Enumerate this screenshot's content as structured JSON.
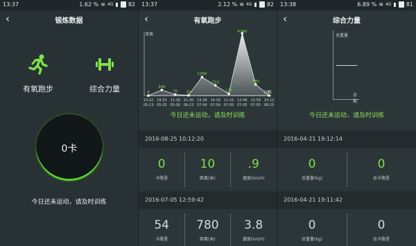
{
  "panels": {
    "p1": {
      "status": {
        "time": "13:37",
        "right": "1.62 % ",
        "signal": "4G",
        "battery": "82"
      },
      "nav": {
        "back": "‹",
        "title": "锻炼数据"
      },
      "categories": [
        {
          "label": "有氧跑步",
          "icon": "running-icon"
        },
        {
          "label": "综合力量",
          "icon": "dumbbell-icon"
        }
      ],
      "ring": {
        "value": "0卡"
      },
      "hint": "今日还未运动，请及时训练"
    },
    "p2": {
      "status": {
        "time": "13:37",
        "right": "2.12 % ",
        "signal": "4G",
        "battery": "82"
      },
      "nav": {
        "back": "‹",
        "title": "有氧跑步"
      },
      "chart_data": {
        "type": "area",
        "y_axis_label": "距离",
        "x_axis_label": "日期",
        "points": [
          {
            "time": "13:22",
            "date": "05-13",
            "value": 0
          },
          {
            "time": "19:33",
            "date": "05-25",
            "value": 390
          },
          {
            "time": "11:18",
            "date": "05-26",
            "value": 70
          },
          {
            "time": "21:30",
            "date": "06-23",
            "value": 20
          },
          {
            "time": "13:38",
            "date": "07-04",
            "value": 1290
          },
          {
            "time": "14:29",
            "date": "07-04",
            "value": 710
          },
          {
            "time": "11:16",
            "date": "07-05",
            "value": 130
          },
          {
            "time": "12:46",
            "date": "07-05",
            "value": 4340
          },
          {
            "time": "12:59",
            "date": "07-05",
            "value": 780
          },
          {
            "time": "10:12",
            "date": "08-25",
            "value": 10
          }
        ],
        "ylim": [
          0,
          4340
        ]
      },
      "hint": "今日还未运动，请及时训练",
      "records": [
        {
          "datetime": "2016-08-25 10:12:20",
          "metrics": [
            {
              "value": "0",
              "caption": "卡路里"
            },
            {
              "value": "10",
              "caption": "距离(米)"
            },
            {
              "value": ".9",
              "caption": "速度(km/h)"
            }
          ]
        },
        {
          "datetime": "2016-07-05 12:59:42",
          "metrics": [
            {
              "value": "54",
              "caption": "卡路里"
            },
            {
              "value": "780",
              "caption": "距离(米)"
            },
            {
              "value": "3.8",
              "caption": "速度(km/h)"
            }
          ]
        }
      ]
    },
    "p3": {
      "status": {
        "time": "13:38",
        "right": "6.89 % ",
        "signal": "4G",
        "battery": "81"
      },
      "nav": {
        "back": "‹",
        "title": "综合力量"
      },
      "chart": {
        "y_axis_label": "总重量",
        "x_axis_label": "日期"
      },
      "hint": "今日还未运动，请及时训练",
      "records": [
        {
          "datetime": "2016-04-21 19:12:14",
          "metrics": [
            {
              "value": "0",
              "caption": "总重量(kg)"
            },
            {
              "value": "0",
              "caption": "总卡路里"
            }
          ]
        },
        {
          "datetime": "2016-04-21 19:11:42",
          "metrics": [
            {
              "value": "0",
              "caption": "总重量(kg)"
            },
            {
              "value": "0",
              "caption": "总卡路里"
            }
          ]
        }
      ]
    }
  },
  "colors": {
    "accent": "#7fe04a",
    "bg": "#2c3638",
    "status_bg": "#1f2729"
  }
}
